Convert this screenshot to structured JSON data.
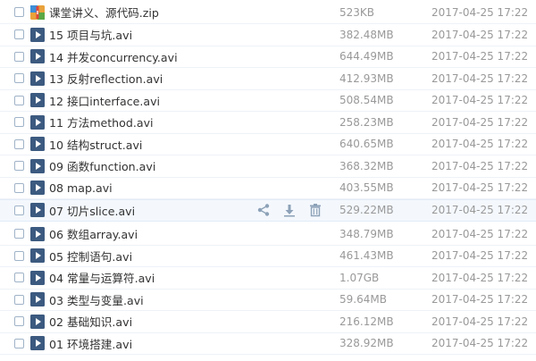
{
  "colors": {
    "video_icon_bg": "#3c5a80",
    "text_primary": "#333333",
    "text_secondary": "#999999",
    "hover_bg": "#f4f8fd",
    "action_icon": "#8da2b8"
  },
  "files": [
    {
      "name": "课堂讲义、源代码.zip",
      "size": "523KB",
      "date": "2017-04-25 17:22",
      "icon": "zip-archive-icon"
    },
    {
      "name": "15 项目与坑.avi",
      "size": "382.48MB",
      "date": "2017-04-25 17:22",
      "icon": "video-file-icon"
    },
    {
      "name": "14 并发concurrency.avi",
      "size": "644.49MB",
      "date": "2017-04-25 17:22",
      "icon": "video-file-icon"
    },
    {
      "name": "13 反射reflection.avi",
      "size": "412.93MB",
      "date": "2017-04-25 17:22",
      "icon": "video-file-icon"
    },
    {
      "name": "12 接口interface.avi",
      "size": "508.54MB",
      "date": "2017-04-25 17:22",
      "icon": "video-file-icon"
    },
    {
      "name": "11 方法method.avi",
      "size": "258.23MB",
      "date": "2017-04-25 17:22",
      "icon": "video-file-icon"
    },
    {
      "name": "10 结构struct.avi",
      "size": "640.65MB",
      "date": "2017-04-25 17:22",
      "icon": "video-file-icon"
    },
    {
      "name": "09 函数function.avi",
      "size": "368.32MB",
      "date": "2017-04-25 17:22",
      "icon": "video-file-icon"
    },
    {
      "name": "08 map.avi",
      "size": "403.55MB",
      "date": "2017-04-25 17:22",
      "icon": "video-file-icon"
    },
    {
      "name": "07 切片slice.avi",
      "size": "529.22MB",
      "date": "2017-04-25 17:22",
      "icon": "video-file-icon"
    },
    {
      "name": "06 数组array.avi",
      "size": "348.79MB",
      "date": "2017-04-25 17:22",
      "icon": "video-file-icon"
    },
    {
      "name": "05 控制语句.avi",
      "size": "461.43MB",
      "date": "2017-04-25 17:22",
      "icon": "video-file-icon"
    },
    {
      "name": "04 常量与运算符.avi",
      "size": "1.07GB",
      "date": "2017-04-25 17:22",
      "icon": "video-file-icon"
    },
    {
      "name": "03 类型与变量.avi",
      "size": "59.64MB",
      "date": "2017-04-25 17:22",
      "icon": "video-file-icon"
    },
    {
      "name": "02 基础知识.avi",
      "size": "216.12MB",
      "date": "2017-04-25 17:22",
      "icon": "video-file-icon"
    },
    {
      "name": "01 环境搭建.avi",
      "size": "328.92MB",
      "date": "2017-04-25 17:22",
      "icon": "video-file-icon"
    }
  ],
  "hover_row_actions": [
    "share-icon",
    "download-icon",
    "delete-icon"
  ]
}
